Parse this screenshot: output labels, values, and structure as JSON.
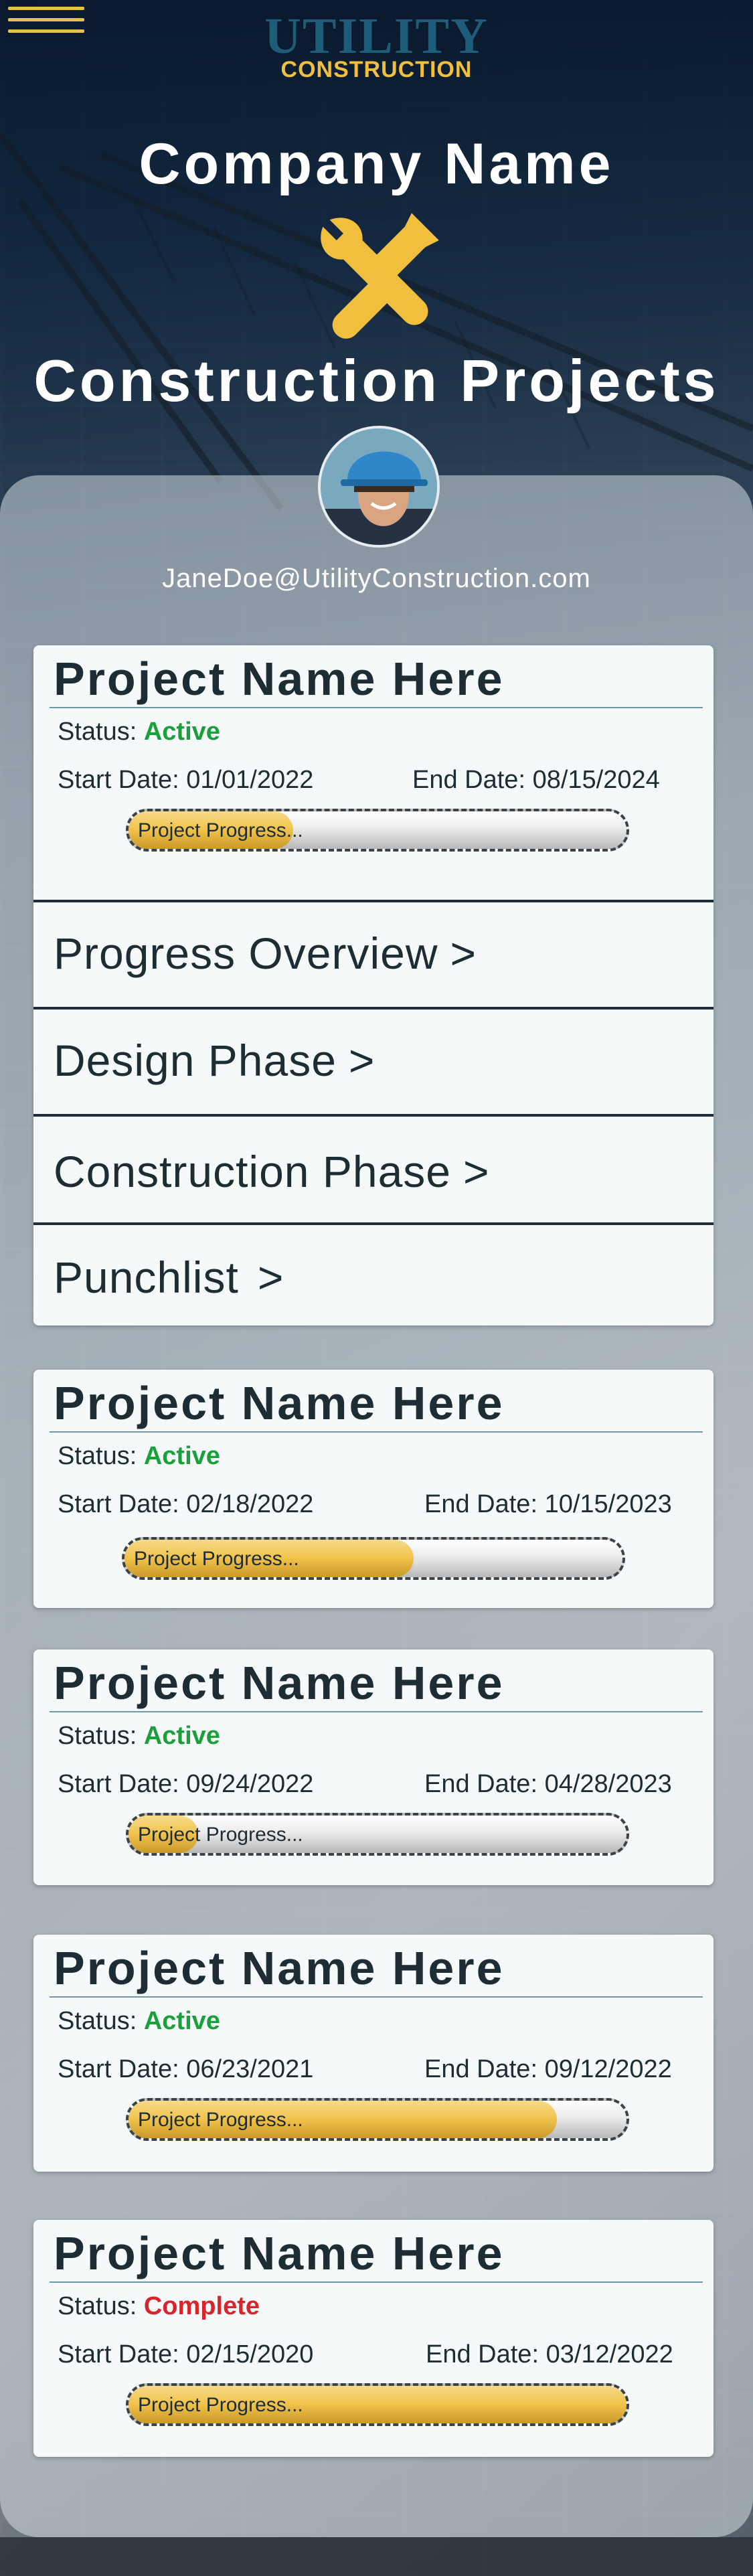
{
  "header": {
    "logo_top": "UTILITY",
    "logo_bottom": "CONSTRUCTION",
    "company_name": "Company Name",
    "section_title": "Construction Projects",
    "user_email": "JaneDoe@UtilityConstruction.com"
  },
  "colors": {
    "accent_gold": "#f0bf3e",
    "logo_teal": "#1d5d7a",
    "status_active": "#1b9f3a",
    "status_complete": "#d8242a",
    "navy_bg": "#10263d"
  },
  "icons": {
    "menu": "hamburger-menu-icon",
    "tools": "wrench-screwdriver-icon",
    "chevron": "chevron-right-icon"
  },
  "labels": {
    "status_prefix": "Status:",
    "start_prefix": "Start Date:",
    "end_prefix": "End Date:",
    "progress_label": "Project Progress..."
  },
  "projects": [
    {
      "title": "Project Name Here",
      "status": "Active",
      "start_date": "01/01/2022",
      "end_date": "08/15/2024",
      "progress": 0.33,
      "expanded": true,
      "menu": [
        {
          "label": "Progress Overview",
          "chevron": ">"
        },
        {
          "label": "Design Phase",
          "chevron": ">"
        },
        {
          "label": "Construction Phase",
          "chevron": ">"
        },
        {
          "label": "Punchlist",
          "chevron": ">"
        }
      ]
    },
    {
      "title": "Project Name Here",
      "status": "Active",
      "start_date": "02/18/2022",
      "end_date": "10/15/2023",
      "progress": 0.58
    },
    {
      "title": "Project Name Here",
      "status": "Active",
      "start_date": "09/24/2022",
      "end_date": "04/28/2023",
      "progress": 0.14
    },
    {
      "title": "Project Name Here",
      "status": "Active",
      "start_date": "06/23/2021",
      "end_date": "09/12/2022",
      "progress": 0.86
    },
    {
      "title": "Project Name Here",
      "status": "Complete",
      "start_date": "02/15/2020",
      "end_date": "03/12/2022",
      "progress": 1.0
    }
  ]
}
